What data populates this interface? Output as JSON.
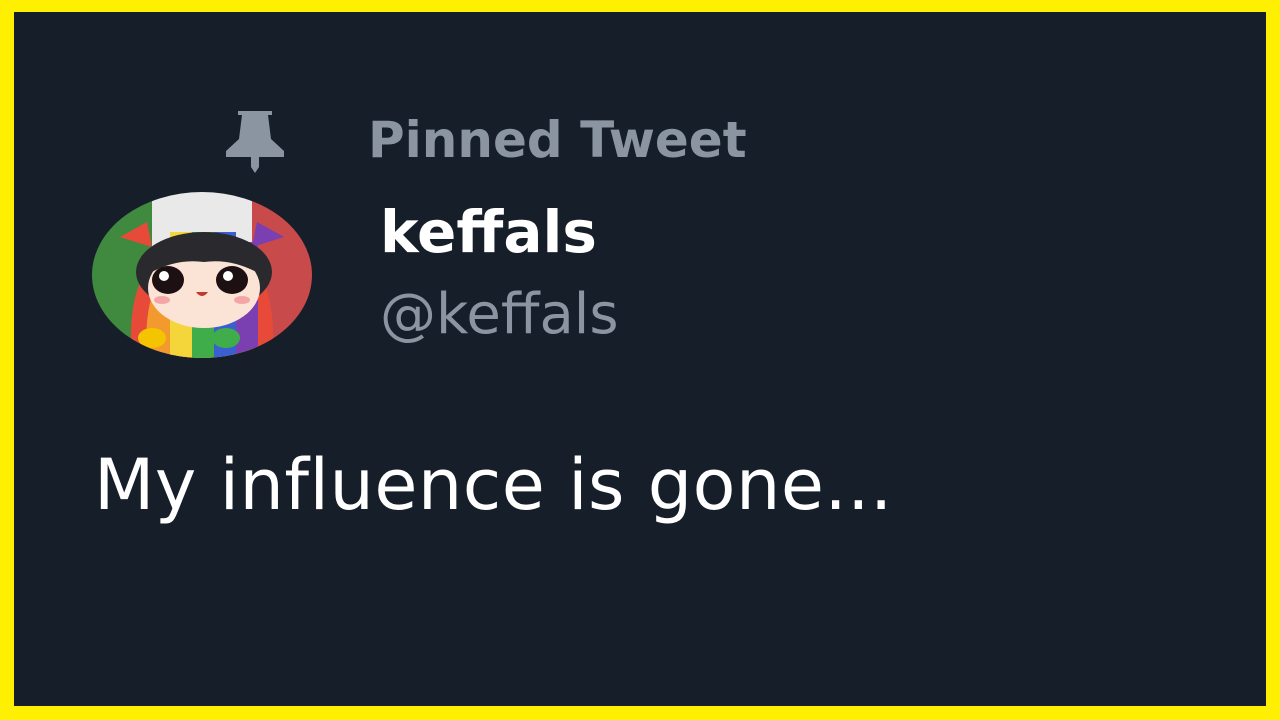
{
  "tweet": {
    "pinned_label": "Pinned Tweet",
    "display_name": "keffals",
    "handle": "@keffals",
    "text": "My influence is gone...",
    "pin_icon": "pin-icon",
    "avatar_icon": "avatar"
  },
  "colors": {
    "frame_border": "#ffef00",
    "background": "#161f29",
    "muted_text": "#8a95a1",
    "primary_text": "#ffffff"
  }
}
